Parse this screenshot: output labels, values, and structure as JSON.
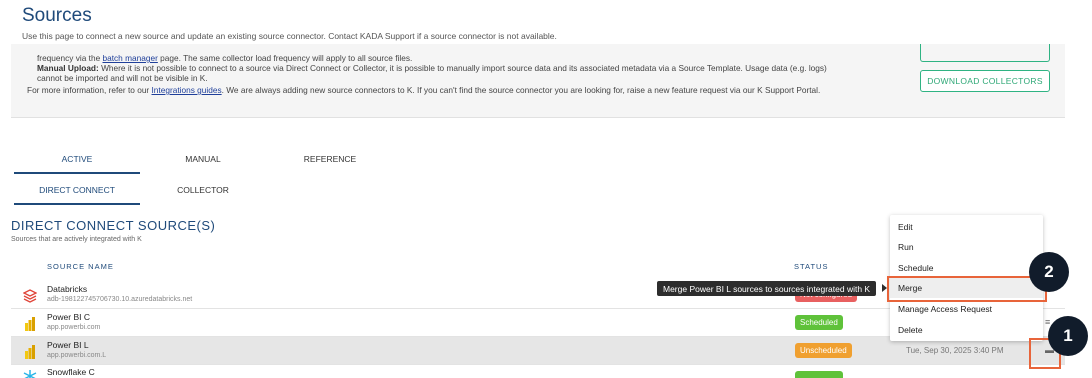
{
  "page": {
    "title": "Sources",
    "subtitle": "Use this page to connect a new source and update an existing source connector. Contact KADA Support if a source connector is not available."
  },
  "info": {
    "line1_pre": "frequency via the ",
    "line1_link": "batch manager",
    "line1_post": " page. The same collector load frequency will apply to all source files.",
    "line2_bold": "Manual Upload:",
    "line2_text": " Where it is not possible to connect to a source via Direct Connect or Collector, it is possible to manually import source data and its associated metadata via a Source Template. Usage data (e.g. logs)",
    "line3": "cannot be imported and will not be visible in K.",
    "line4_pre": "For more information, refer to our ",
    "line4_link": "Integrations guides",
    "line4_post": ". We are always adding new source connectors to K. If you can't find the source connector you are looking for, raise a new feature request via our K Support Portal.",
    "download_button": "DOWNLOAD COLLECTORS"
  },
  "tabs": [
    "ACTIVE",
    "MANUAL",
    "REFERENCE"
  ],
  "subtabs": [
    "DIRECT CONNECT",
    "COLLECTOR"
  ],
  "section": {
    "title": "DIRECT CONNECT SOURCE(S)",
    "subtitle": "Sources that are actively integrated with K"
  },
  "columns": {
    "name": "SOURCE NAME",
    "status": "STATUS"
  },
  "rows": [
    {
      "name": "Databricks",
      "host": "adb-198122745706730.10.azuredatabricks.net",
      "status": "Not configured",
      "date": "",
      "icon": "databricks-icon"
    },
    {
      "name": "Power BI C",
      "host": "app.powerbi.com",
      "status": "Scheduled",
      "date": "",
      "icon": "powerbi-icon"
    },
    {
      "name": "Power BI L",
      "host": "app.powerbi.com.L",
      "status": "Unscheduled",
      "date": "Tue, Sep 30, 2025 3:40 PM",
      "icon": "powerbi-icon"
    },
    {
      "name": "Snowflake C",
      "host": "",
      "status": "",
      "date": "",
      "icon": "snowflake-icon"
    }
  ],
  "menu": [
    "Edit",
    "Run",
    "Schedule",
    "Merge",
    "Manage Access Request",
    "Delete"
  ],
  "tooltip": "Merge Power BI L sources to sources integrated with K",
  "badges": [
    "1",
    "2"
  ],
  "colors": {
    "accent": "#1f4a7a",
    "green": "#5fc23a",
    "orange": "#f0a030",
    "callout": "#e8643a"
  }
}
